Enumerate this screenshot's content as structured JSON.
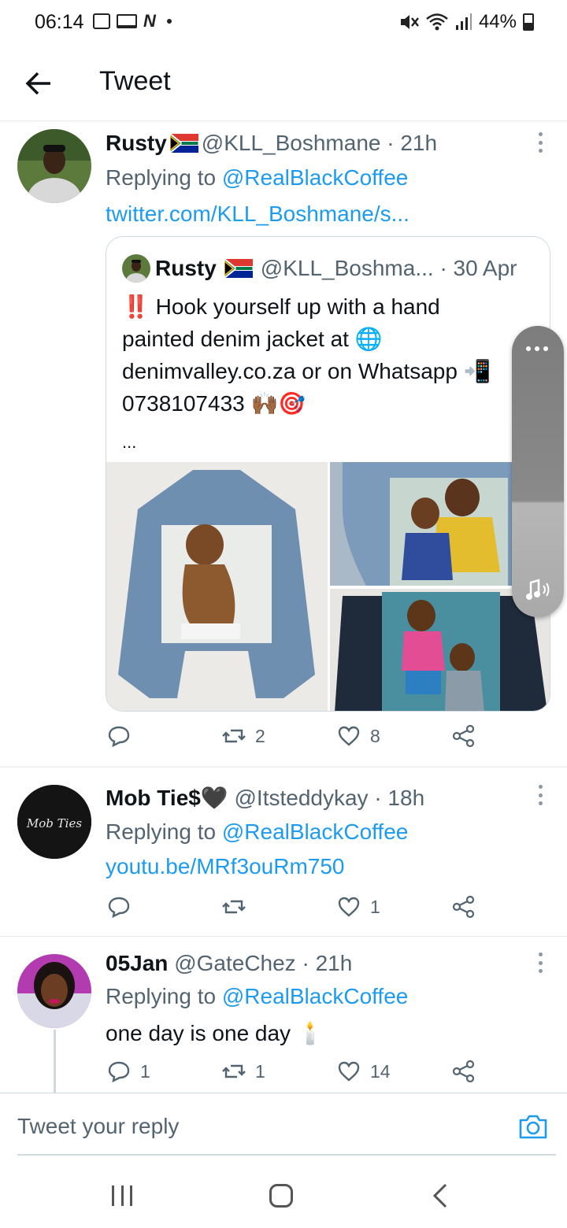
{
  "status_bar": {
    "time": "06:14",
    "battery": "44%"
  },
  "header": {
    "title": "Tweet"
  },
  "tweets": [
    {
      "name": "Rusty",
      "handle": "@KLL_Boshmane · 21h",
      "replying_prefix": "Replying to",
      "replying_to": "@RealBlackCoffee",
      "link": "twitter.com/KLL_Boshmane/s...",
      "quote": {
        "name": "Rusty",
        "handle": "@KLL_Boshma... · 30 Apr",
        "text_1": "‼️ Hook yourself up with a hand",
        "text_2": "painted denim jacket at 🌐",
        "text_3": "denimvalley.co.za or on Whatsapp 📲",
        "text_4": "0738107433 🙌🏾🎯",
        "more": "..."
      },
      "reply_count": "",
      "retweet_count": "2",
      "like_count": "8"
    },
    {
      "name": "Mob Tie$🖤",
      "handle": "@Itsteddykay · 18h",
      "replying_prefix": "Replying to",
      "replying_to": "@RealBlackCoffee",
      "link": "youtu.be/MRf3ouRm750",
      "avatar_text": "Mob Ties",
      "reply_count": "",
      "retweet_count": "",
      "like_count": "1"
    },
    {
      "name": "05Jan",
      "handle": "@GateChez · 21h",
      "replying_prefix": "Replying to",
      "replying_to": "@RealBlackCoffee",
      "text": "one day is one day 🕯️",
      "reply_count": "1",
      "retweet_count": "1",
      "like_count": "14"
    }
  ],
  "reply_bar": {
    "placeholder": "Tweet your reply"
  },
  "colors": {
    "link": "#1d9bf0",
    "muted": "#536471",
    "text": "#0f1419",
    "border": "#e6ecf0"
  },
  "icons": [
    "back-arrow-icon",
    "more-icon",
    "reply-icon",
    "retweet-icon",
    "like-icon",
    "share-icon",
    "camera-icon"
  ]
}
